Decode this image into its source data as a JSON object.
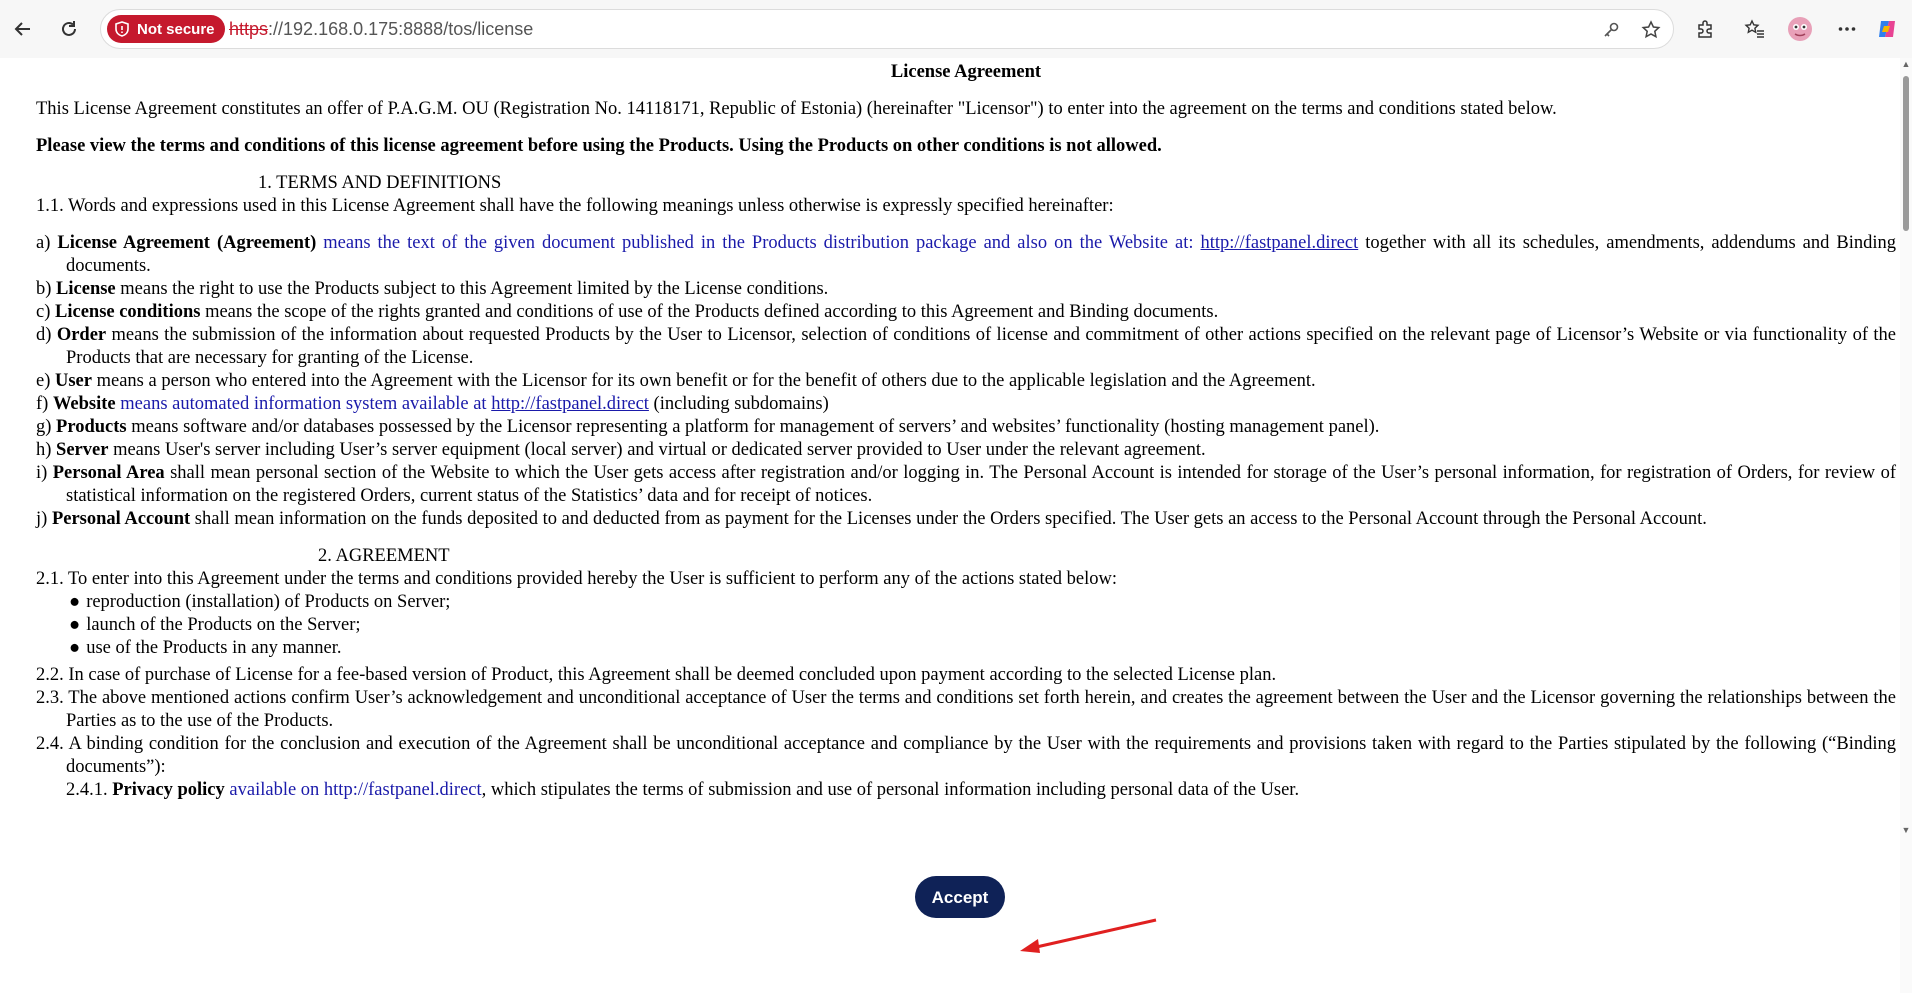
{
  "browser": {
    "not_secure_label": "Not secure",
    "url_scheme": "https",
    "url_rest": "://192.168.0.175:8888/tos/license",
    "accent_warning": "#c5192d"
  },
  "doc": {
    "title": "License Agreement",
    "intro": "This License Agreement constitutes an offer of P.A.G.M. OU (Registration No. 14118171, Republic of Estonia) (hereinafter \"Licensor\") to enter into the agreement on the terms and conditions stated below.",
    "warning": "Please view the terms and conditions of this license agreement before using the Products. Using the Products on other conditions is not allowed.",
    "section1_title": "1. TERMS AND DEFINITIONS",
    "s1_1": "1.1. Words and expressions used in this License Agreement shall have the following meanings unless otherwise is expressly specified hereinafter:",
    "def_a": {
      "prefix": "a) ",
      "term": "License Agreement (Agreement)",
      "blue": " means the text of the given document published in the Products distribution package and also on the Website at: ",
      "link": "http://fastpanel.direct",
      "tail": " together with all its schedules, amendments, addendums and Binding documents."
    },
    "def_b": {
      "prefix": "b) ",
      "term": "License",
      "tail": " means the right to use the Products subject to this Agreement limited by the License conditions."
    },
    "def_c": {
      "prefix": "c) ",
      "term": "License conditions",
      "tail": " means the scope of the rights granted and conditions of use of the Products defined according to this Agreement and Binding documents."
    },
    "def_d": {
      "prefix": "d) ",
      "term": "Order",
      "tail": " means the submission of the information about requested Products by the User to Licensor, selection of conditions of license and commitment of other actions specified on the relevant page of Licensor’s Website or via functionality of the Products that are necessary for granting of the License."
    },
    "def_e": {
      "prefix": "e) ",
      "term": "User",
      "tail": " means a person who entered into the Agreement with the Licensor for its own benefit or for the benefit of others due to the applicable legislation and the Agreement."
    },
    "def_f": {
      "prefix": "f) ",
      "term": "Website",
      "blue": " means automated information system available at ",
      "link": "http://fastpanel.direct",
      "tail": " (including subdomains)"
    },
    "def_g": {
      "prefix": "g) ",
      "term": "Products",
      "tail": " means software and/or databases possessed by the Licensor representing a platform for management of servers’ and websites’ functionality (hosting management panel)."
    },
    "def_h": {
      "prefix": "h) ",
      "term": "Server",
      "tail": " means User's server including User’s server equipment (local server) and virtual or dedicated server provided to User under the relevant agreement."
    },
    "def_i": {
      "prefix": "i) ",
      "term": "Personal Area",
      "tail": " shall mean personal section of the Website to which the User gets access after registration and/or logging in. The Personal Account is intended for storage of the User’s personal information, for registration of Orders, for review of statistical information on the registered Orders, current status of the Statistics’ data and for receipt of notices."
    },
    "def_j": {
      "prefix": "j) ",
      "term": "Personal Account",
      "tail": " shall mean information on the funds deposited to and deducted from as payment for the Licenses under the Orders specified. The User gets an access to the Personal Account through the Personal Account."
    },
    "section2_title": "2. AGREEMENT",
    "s2_1": "2.1. To enter into this Agreement under the terms and conditions provided hereby the User is sufficient to perform any of the actions stated below:",
    "bullets": [
      "reproduction (installation) of Products on Server;",
      "launch of the Products on the Server;",
      "use of the Products in any manner."
    ],
    "s2_2": "2.2. In case of purchase of License for a fee-based version of Product, this Agreement shall be deemed concluded upon payment according to the selected License plan.",
    "s2_3": "2.3. The above mentioned actions confirm User’s acknowledgement and unconditional acceptance of User the terms and conditions set forth herein, and creates the agreement between the User and the Licensor governing the relationships between the Parties as to the use of the Products.",
    "s2_4": "2.4. A binding condition for the conclusion and execution of the Agreement shall be unconditional acceptance and compliance by the User with the requirements and provisions taken with regard to the Parties stipulated by the following (“Binding documents”):",
    "s2_4_1": {
      "prefix": "2.4.1. ",
      "term": "Privacy policy",
      "blue": " available on http://fastpanel.direct",
      "tail": ", which stipulates the terms of submission and use of personal information including personal data of the User."
    }
  },
  "accept": {
    "label": "Accept",
    "color": "#0f2257"
  },
  "annotation_arrow_color": "#e02020"
}
